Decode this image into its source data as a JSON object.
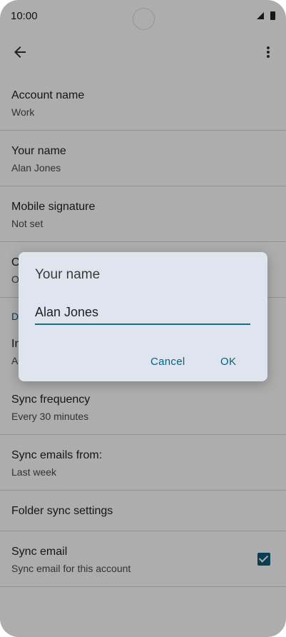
{
  "status_bar": {
    "time": "10:00"
  },
  "app_bar": {
    "back_icon": "arrow-back-icon",
    "menu_icon": "more-vert-icon"
  },
  "settings": {
    "account_name": {
      "title": "Account name",
      "value": "Work"
    },
    "your_name": {
      "title": "Your name",
      "value": "Alan Jones"
    },
    "mobile_signature": {
      "title": "Mobile signature",
      "value": "Not set"
    },
    "hidden_1": {
      "title": "O",
      "value": "O"
    },
    "section_header": "D",
    "hidden_2": {
      "title": "In",
      "value": "A"
    },
    "sync_frequency": {
      "title": "Sync frequency",
      "value": "Every 30 minutes"
    },
    "sync_emails_from": {
      "title": "Sync emails from:",
      "value": "Last week"
    },
    "folder_sync": {
      "title": "Folder sync settings"
    },
    "sync_email": {
      "title": "Sync email",
      "value": "Sync email for this account",
      "checked": true
    }
  },
  "dialog": {
    "title": "Your name",
    "input_value": "Alan Jones",
    "cancel_label": "Cancel",
    "ok_label": "OK"
  },
  "colors": {
    "accent": "#0d5d7d",
    "dialog_bg": "#dfe5ee"
  }
}
